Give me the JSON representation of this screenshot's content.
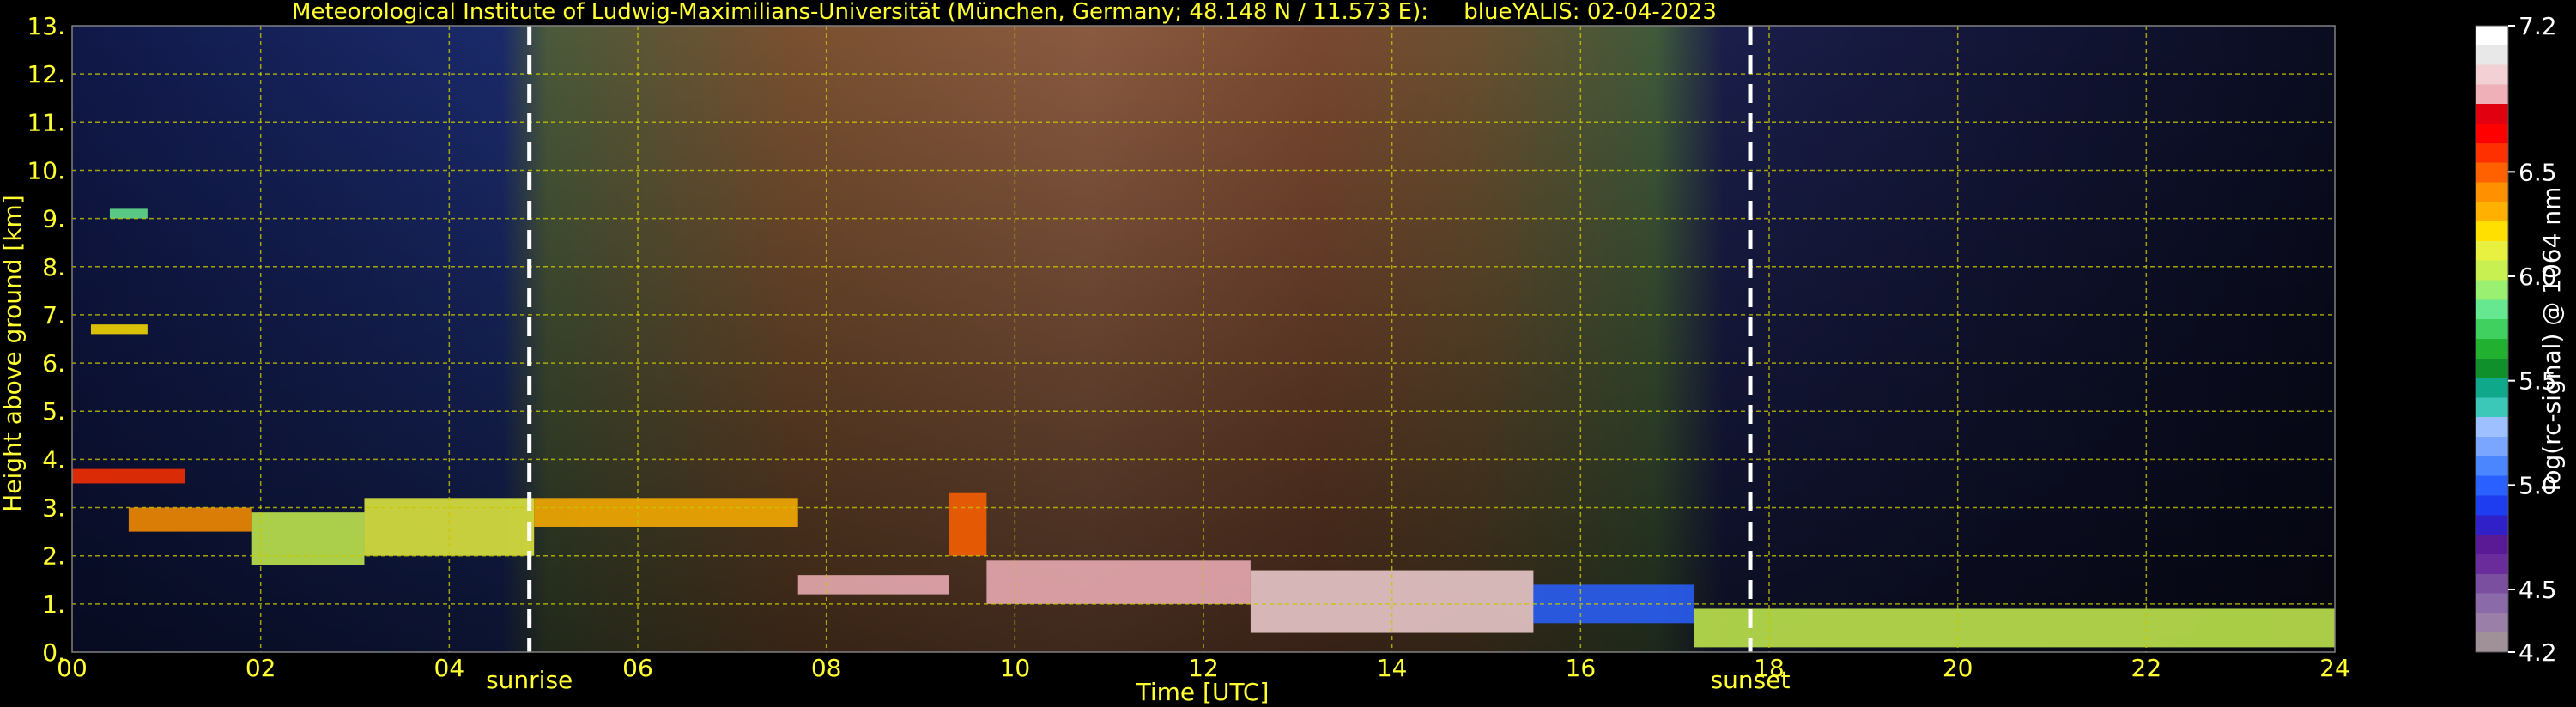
{
  "chart_data": {
    "type": "heatmap",
    "title": "Meteorological Institute of Ludwig-Maximilians-Universität (München, Germany; 48.148 N / 11.573 E):     blueYALIS: 02-04-2023",
    "xlabel": "Time [UTC]",
    "ylabel": "Height above ground [km]",
    "xlim": [
      0,
      24
    ],
    "ylim": [
      0,
      13
    ],
    "x_ticks": [
      "00",
      "02",
      "04",
      "06",
      "08",
      "10",
      "12",
      "14",
      "16",
      "18",
      "20",
      "22",
      "24"
    ],
    "y_ticks": [
      "0.",
      "1.",
      "2.",
      "3.",
      "4.",
      "5.",
      "6.",
      "7.",
      "8.",
      "9.",
      "10.",
      "11.",
      "12.",
      "13."
    ],
    "grid": true,
    "markers": [
      {
        "label": "sunrise",
        "x": 4.85
      },
      {
        "label": "sunset",
        "x": 17.8
      }
    ],
    "colorbar": {
      "label": "log(rc-signal) @ 1064 nm",
      "range": [
        4.2,
        7.2
      ],
      "ticks": [
        "4.2",
        "4.5",
        "5.0",
        "5.5",
        "6.0",
        "6.5",
        "7.2"
      ],
      "tick_values": [
        4.2,
        4.5,
        5.0,
        5.5,
        6.0,
        6.5,
        7.2
      ],
      "colors": [
        "#a09098",
        "#9a80a8",
        "#8a6aa8",
        "#7a4fa0",
        "#6a2c9a",
        "#5a1a96",
        "#3020c8",
        "#1e3cf0",
        "#2a60ff",
        "#4c86ff",
        "#7aa6ff",
        "#9ec0ff",
        "#3cc8b8",
        "#10a88a",
        "#10902a",
        "#22b030",
        "#40d060",
        "#66e890",
        "#9af070",
        "#c8f050",
        "#e8f040",
        "#ffe000",
        "#ffb000",
        "#ff9000",
        "#ff6000",
        "#ff3000",
        "#ff0000",
        "#e00010",
        "#f0b0b8",
        "#f2d0d4",
        "#e8e8e8",
        "#ffffff"
      ]
    },
    "cloud_layers": [
      {
        "x0": 0.0,
        "x1": 1.2,
        "y0": 3.5,
        "y1": 3.8,
        "level": 6.6
      },
      {
        "x0": 0.6,
        "x1": 1.9,
        "y0": 2.5,
        "y1": 3.0,
        "level": 6.4
      },
      {
        "x0": 1.9,
        "x1": 3.1,
        "y0": 1.8,
        "y1": 2.9,
        "level": 6.0
      },
      {
        "x0": 3.1,
        "x1": 4.9,
        "y0": 2.0,
        "y1": 3.2,
        "level": 6.1
      },
      {
        "x0": 4.9,
        "x1": 7.7,
        "y0": 2.6,
        "y1": 3.2,
        "level": 6.3
      },
      {
        "x0": 7.7,
        "x1": 9.3,
        "y0": 1.2,
        "y1": 1.6,
        "level": 6.9
      },
      {
        "x0": 9.3,
        "x1": 9.7,
        "y0": 2.0,
        "y1": 3.3,
        "level": 6.5
      },
      {
        "x0": 9.7,
        "x1": 12.5,
        "y0": 1.0,
        "y1": 1.9,
        "level": 6.9
      },
      {
        "x0": 12.5,
        "x1": 15.5,
        "y0": 0.4,
        "y1": 1.7,
        "level": 7.0
      },
      {
        "x0": 15.5,
        "x1": 17.2,
        "y0": 0.6,
        "y1": 1.4,
        "level": 5.0
      },
      {
        "x0": 17.2,
        "x1": 24.0,
        "y0": 0.1,
        "y1": 0.9,
        "level": 6.0
      },
      {
        "x0": 0.2,
        "x1": 0.8,
        "y0": 6.6,
        "y1": 6.8,
        "level": 6.2
      },
      {
        "x0": 0.4,
        "x1": 0.8,
        "y0": 9.0,
        "y1": 9.2,
        "level": 5.8
      }
    ]
  }
}
